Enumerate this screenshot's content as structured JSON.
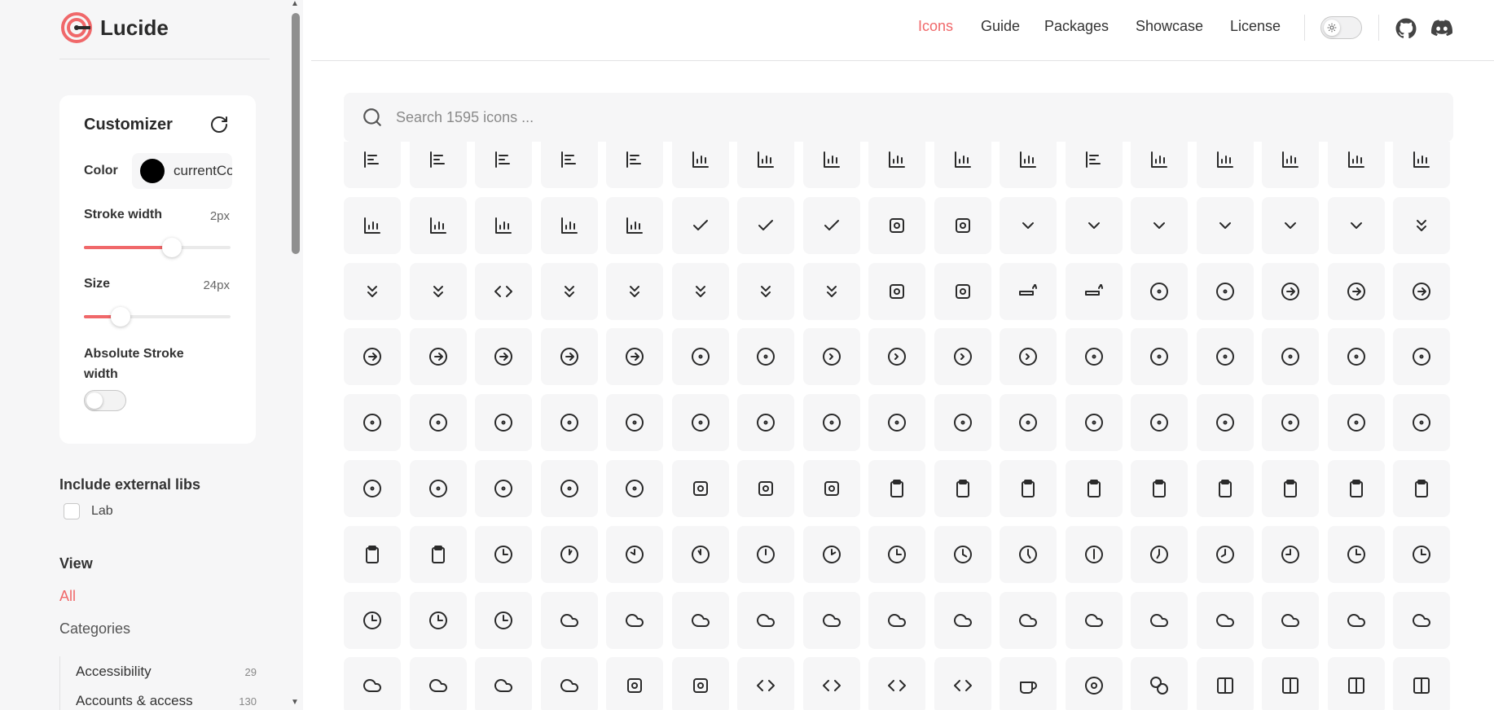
{
  "app": {
    "name": "Lucide",
    "brand_color": "#f0686a"
  },
  "nav": {
    "items": [
      {
        "label": "Icons",
        "active": true
      },
      {
        "label": "Guide",
        "active": false
      },
      {
        "label": "Packages",
        "active": false
      },
      {
        "label": "Showcase",
        "active": false
      },
      {
        "label": "License",
        "active": false
      }
    ],
    "theme_icon": "sun-icon",
    "github_icon": "github-icon",
    "discord_icon": "discord-icon"
  },
  "customizer": {
    "title": "Customizer",
    "reset_icon": "rotate-cw-icon",
    "color_label": "Color",
    "color_value": "currentColor",
    "swatch_color": "#000000",
    "stroke_label": "Stroke width",
    "stroke_value": "2px",
    "stroke_fraction": 0.6,
    "size_label": "Size",
    "size_value": "24px",
    "size_fraction": 0.25,
    "absolute_label": "Absolute Stroke width",
    "absolute_on": false
  },
  "external": {
    "title": "Include external libs",
    "lab_label": "Lab",
    "lab_checked": false
  },
  "view": {
    "title": "View",
    "all_label": "All",
    "categories_label": "Categories",
    "categories": [
      {
        "label": "Accessibility",
        "count": "29"
      },
      {
        "label": "Accounts & access",
        "count": "130"
      }
    ]
  },
  "search": {
    "placeholder": "Search 1595 icons ...",
    "value": ""
  },
  "icons": {
    "rows": [
      [
        "align-start-vertical",
        "align-horizontal-distribute-start",
        "align-left",
        "align-end-vertical",
        "align-vertical-distribute-start",
        "candlestick-chart",
        "bar-chart",
        "bar-chart-big",
        "bar-chart-horizontal",
        "bar-chart-3",
        "bar-chart-4",
        "gantt-chart",
        "line-chart",
        "chart-scatter-line",
        "bar-chart-2",
        "bar-chart-decreasing",
        "bar-chart-increasing"
      ],
      [
        "chart-area",
        "chart-bar",
        "pie-chart",
        "scatter-chart",
        "chart-line",
        "check",
        "check-check",
        "check-line",
        "chef-hat",
        "cherry",
        "chevron-down",
        "chevron-first",
        "chevron-last",
        "chevron-left",
        "chevron-right",
        "chevron-up",
        "chevrons-down"
      ],
      [
        "chevrons-down-up",
        "chevrons-left",
        "code",
        "chevrons-left-right-ellipsis",
        "chevrons-right",
        "chevrons-right-left",
        "chevrons-up",
        "chevrons-up-down",
        "chrome",
        "church",
        "cigarette",
        "cigarette-off",
        "circle",
        "circle-alert",
        "circle-arrow-down",
        "circle-arrow-left",
        "circle-arrow-out-down-left"
      ],
      [
        "circle-arrow-out-down-right",
        "circle-arrow-out-up-left",
        "circle-arrow-out-up-right",
        "circle-arrow-right",
        "circle-arrow-up",
        "circle-check",
        "circle-check-big",
        "circle-chevron-down",
        "circle-chevron-left",
        "circle-chevron-right",
        "circle-chevron-up",
        "circle-dashed",
        "circle-divide",
        "circle-dollar-sign",
        "circle-dot",
        "circle-dot-dashed",
        "circle-ellipsis"
      ],
      [
        "circle-equal",
        "circle-fading-arrow-up",
        "circle-fading-plus",
        "circle-gauge",
        "circle-help",
        "circle-minus",
        "circle-off",
        "circle-parking",
        "circle-parking-off",
        "circle-pause",
        "circle-percent",
        "circle-play",
        "circle-plus",
        "circle-pound-sterling",
        "circle-power",
        "circle-slash",
        "circle-slash-2"
      ],
      [
        "circle-small",
        "circle-stop",
        "circle-user",
        "circle-user-round",
        "circle-x",
        "circuit-board",
        "citrus",
        "clapperboard",
        "clipboard",
        "clipboard-check",
        "clipboard-copy",
        "clipboard-list",
        "clipboard-minus",
        "clipboard-paste",
        "clipboard-pen",
        "clipboard-pen-line",
        "clipboard-plus"
      ],
      [
        "clipboard-type",
        "clipboard-x",
        "clock",
        "clock-1",
        "clock-10",
        "clock-11",
        "clock-12",
        "clock-2",
        "clock-3",
        "clock-4",
        "clock-5",
        "clock-6",
        "clock-7",
        "clock-8",
        "clock-9",
        "clock-alert",
        "clock-arrow-down"
      ],
      [
        "clock-arrow-up",
        "clock-fading",
        "clock-plus",
        "cloud",
        "cloud-alert",
        "cloud-cog",
        "cloud-download",
        "cloud-drizzle",
        "cloud-fog",
        "cloud-hail",
        "cloud-lightning",
        "cloud-moon",
        "cloud-moon-rain",
        "cloud-off",
        "cloud-rain",
        "cloud-rain-wind",
        "cloud-snow"
      ],
      [
        "cloud-sun",
        "cloud-sun-rain",
        "cloud-upload",
        "cloudy",
        "clover",
        "club",
        "code-2",
        "code-xml",
        "codepen",
        "codesandbox",
        "coffee",
        "cog",
        "coins",
        "columns-2",
        "columns-3",
        "columns-3-cog",
        "columns-4"
      ]
    ]
  }
}
